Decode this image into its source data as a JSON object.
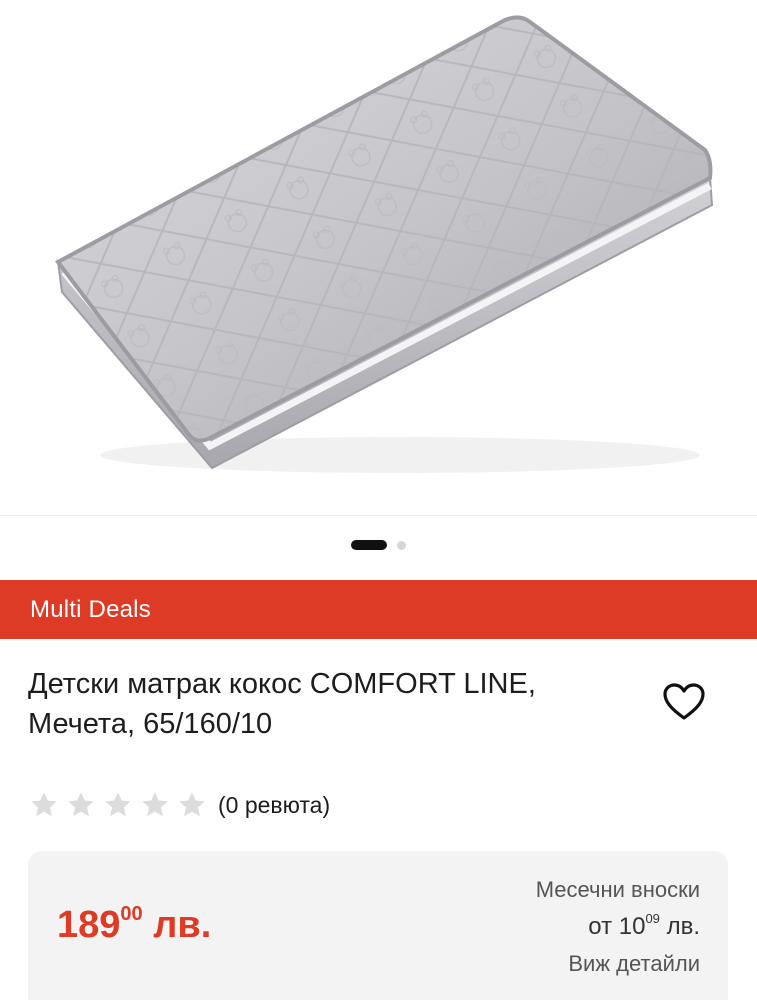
{
  "gallery": {
    "image_alt": "Детски матрак кокос COMFORT LINE, Мечета, 65/160/10",
    "slides_total": 2,
    "active_slide": 1
  },
  "seller": {
    "name": "Multi Deals",
    "banner_color": "#dd3b25"
  },
  "product": {
    "title": "Детски матрак кокос COMFORT LINE, Мечета, 65/160/10"
  },
  "rating": {
    "stars_filled": 0,
    "stars_total": 5,
    "reviews_text": "(0 ревюта)"
  },
  "price": {
    "integer": "189",
    "decimals": "00",
    "currency": "лв.",
    "color": "#dd3b25"
  },
  "installments": {
    "label": "Месечни вноски",
    "prefix": "от",
    "integer": "10",
    "decimals": "09",
    "currency": "лв.",
    "details_link": "Виж детайли"
  }
}
